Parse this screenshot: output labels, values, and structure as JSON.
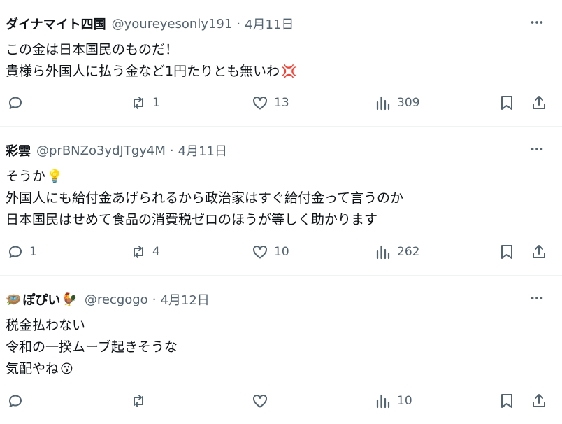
{
  "tweets": [
    {
      "avatar_emoji": "",
      "name": "ダイナマイト四国",
      "name_suffix": "",
      "handle": "@youreyesonly191",
      "separator": "·",
      "date": "4月11日",
      "lines": [
        "この金は日本国民のものだ！",
        "貴様ら外国人に払う金など1円たりとも無いわ"
      ],
      "emojis": [
        "",
        "💢"
      ],
      "reply_count": "",
      "retweet_count": "1",
      "like_count": "13",
      "view_count": "309"
    },
    {
      "avatar_emoji": "",
      "name": "彩雲",
      "name_suffix": "",
      "handle": "@prBNZo3ydJTgy4M",
      "separator": "·",
      "date": "4月11日",
      "lines": [
        "そうか",
        "外国人にも給付金あげられるから政治家はすぐ給付金って言うのか",
        "日本国民はせめて食品の消費税ゼロのほうが等しく助かります"
      ],
      "emojis": [
        "💡",
        "",
        ""
      ],
      "reply_count": "1",
      "retweet_count": "4",
      "like_count": "10",
      "view_count": "262"
    },
    {
      "avatar_emoji": "🪺",
      "name": "ぽぴい",
      "name_suffix": "🐓",
      "handle": "@recgogo",
      "separator": "·",
      "date": "4月12日",
      "lines": [
        "税金払わない",
        "令和の一揆ムーブ起きそうな",
        "気配やね"
      ],
      "emojis": [
        "",
        "",
        "😗"
      ],
      "reply_count": "",
      "retweet_count": "",
      "like_count": "",
      "view_count": "10"
    }
  ],
  "icons": {
    "more": "more-dots-icon",
    "reply": "reply-bubble-icon",
    "retweet": "retweet-arrows-icon",
    "like": "heart-icon",
    "views": "analytics-bars-icon",
    "bookmark": "bookmark-icon",
    "share": "share-upload-icon"
  },
  "colors": {
    "text": "#0f1419",
    "secondary": "#536471",
    "divider": "#eff3f4"
  }
}
